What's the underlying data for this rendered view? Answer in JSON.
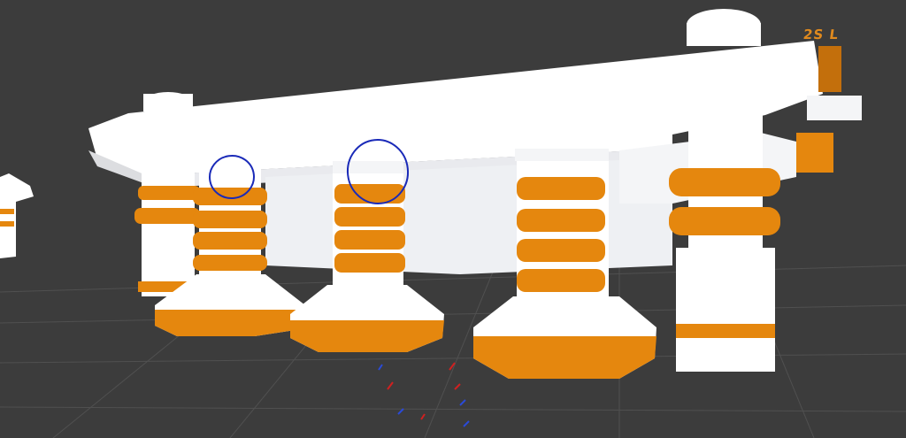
{
  "viewport": {
    "background": "#3c3c3c",
    "grid_color": "#505050",
    "label_text": "2S L"
  },
  "model": {
    "primary_color": "#ffffff",
    "shade_color": "#dcdde0",
    "accent_color": "#e5870e",
    "accent_shade": "#b8680a",
    "spring_count": 7,
    "annotation_color": "#1a2ab8",
    "annotation_count": 2
  },
  "gizmo": {
    "colors": [
      "#d02020",
      "#2a4ad8"
    ]
  }
}
